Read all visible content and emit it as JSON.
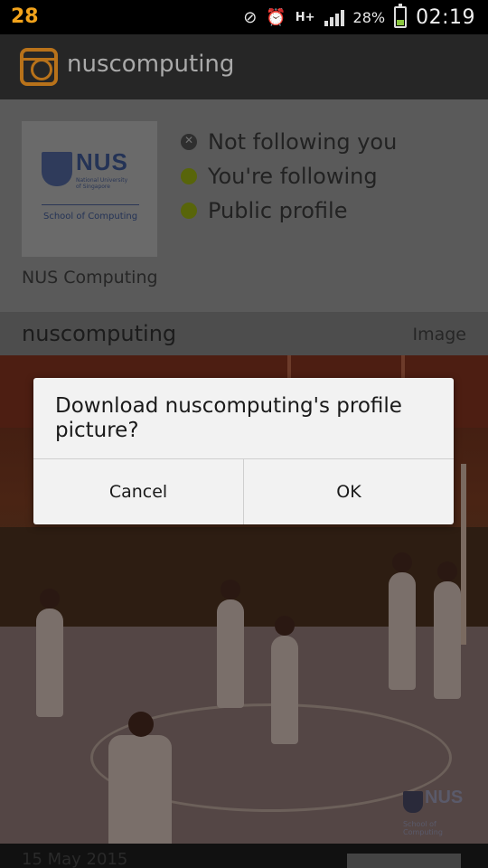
{
  "status_bar": {
    "notification_badge": "28",
    "icons": [
      "mute-icon",
      "alarm-icon",
      "hplus-data-icon",
      "signal-icon"
    ],
    "network_type": "H+",
    "battery_percent": "28%",
    "battery_level": 0.28,
    "time": "02:19",
    "badge_color": "#f2a31b"
  },
  "app_bar": {
    "title": "nuscomputing",
    "logo_icon": "instagram-camera-icon",
    "accent_color": "#b8721a"
  },
  "profile": {
    "picture_brand": "NUS",
    "picture_subtitle": "National University of Singapore",
    "picture_department": "School of Computing",
    "display_name": "NUS Computing",
    "statuses": [
      {
        "label": "Not following you",
        "state": "inactive"
      },
      {
        "label": "You're following",
        "state": "active"
      },
      {
        "label": "Public profile",
        "state": "active"
      }
    ]
  },
  "section": {
    "username": "nuscomputing",
    "media_type": "Image"
  },
  "post": {
    "watermark": "NUS",
    "watermark_sub": "School of Computing",
    "date": "15 May 2015"
  },
  "dialog": {
    "message": "Download nuscomputing's profile picture?",
    "cancel_label": "Cancel",
    "ok_label": "OK"
  }
}
